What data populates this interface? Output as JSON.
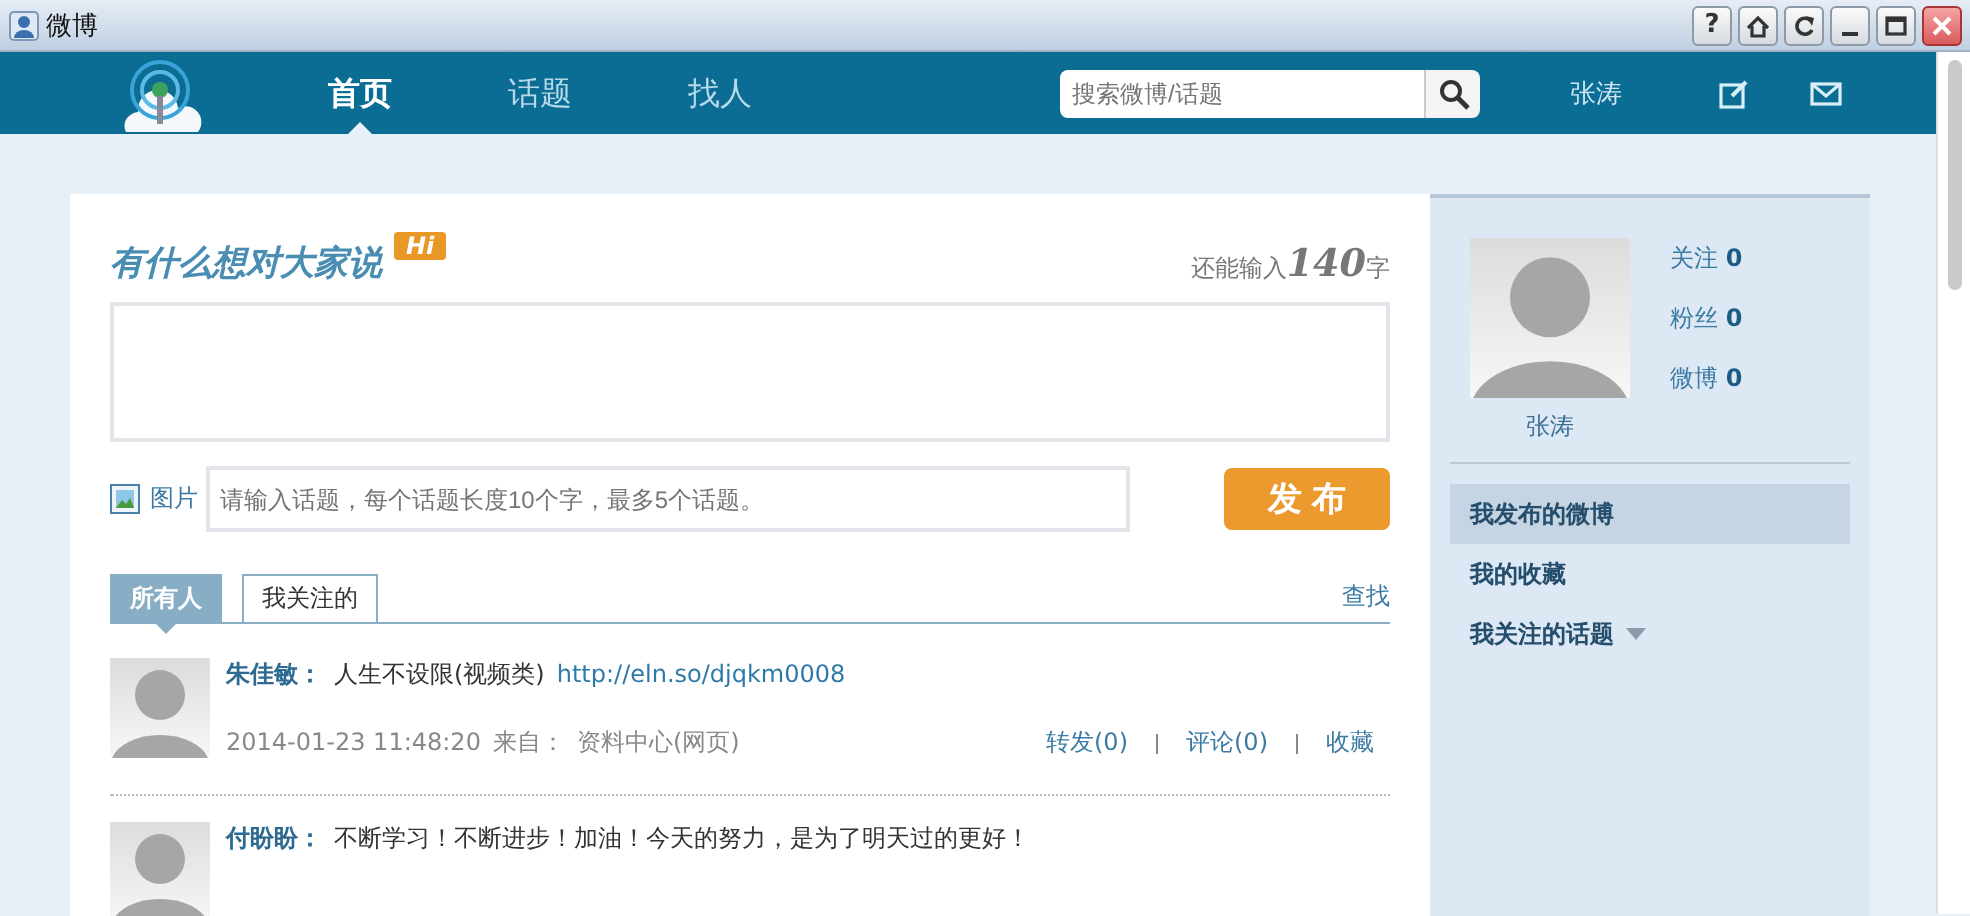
{
  "window": {
    "title": "微博",
    "buttons": [
      {
        "kind": "help",
        "label": "?"
      },
      {
        "kind": "home"
      },
      {
        "kind": "refresh"
      },
      {
        "kind": "minimize"
      },
      {
        "kind": "maximize"
      },
      {
        "kind": "close"
      }
    ]
  },
  "nav": {
    "tabs": [
      {
        "label": "首页",
        "selected": true
      },
      {
        "label": "话题",
        "selected": false
      },
      {
        "label": "找人",
        "selected": false
      }
    ],
    "search": {
      "placeholder": "搜索微博/话题"
    },
    "user": "张涛"
  },
  "compose": {
    "title": "有什么想对大家说",
    "badge": "Hi",
    "counter_prefix": "还能输入",
    "counter": "140",
    "counter_suffix": "字",
    "picture_label": "图片",
    "topic_placeholder": "请输入话题，每个话题长度10个字，最多5个话题。",
    "submit": "发 布"
  },
  "feed": {
    "tabs": [
      {
        "label": "所有人",
        "selected": true
      },
      {
        "label": "我关注的",
        "selected": false
      }
    ],
    "find": "查找",
    "posts": [
      {
        "name": "朱佳敏",
        "separator": "：",
        "text": "人生不设限(视频类)",
        "link": "http://eln.so/djqkm0008",
        "time": "2014-01-23 11:48:20",
        "source_label": "来自：",
        "source": "资料中心(网页)",
        "actions": [
          "转发(0)",
          "评论(0)",
          "收藏"
        ]
      },
      {
        "name": "付盼盼",
        "separator": "：",
        "text": "不断学习！不断进步！加油！今天的努力，是为了明天过的更好！"
      }
    ]
  },
  "profile": {
    "name": "张涛",
    "stats": [
      {
        "label": "关注",
        "value": "0"
      },
      {
        "label": "粉丝",
        "value": "0"
      },
      {
        "label": "微博",
        "value": "0"
      }
    ],
    "menu": [
      {
        "label": "我发布的微博",
        "selected": true,
        "kind": "link"
      },
      {
        "label": "我的收藏",
        "selected": false,
        "kind": "link"
      },
      {
        "label": "我关注的话题",
        "selected": false,
        "kind": "dropdown"
      }
    ]
  }
}
